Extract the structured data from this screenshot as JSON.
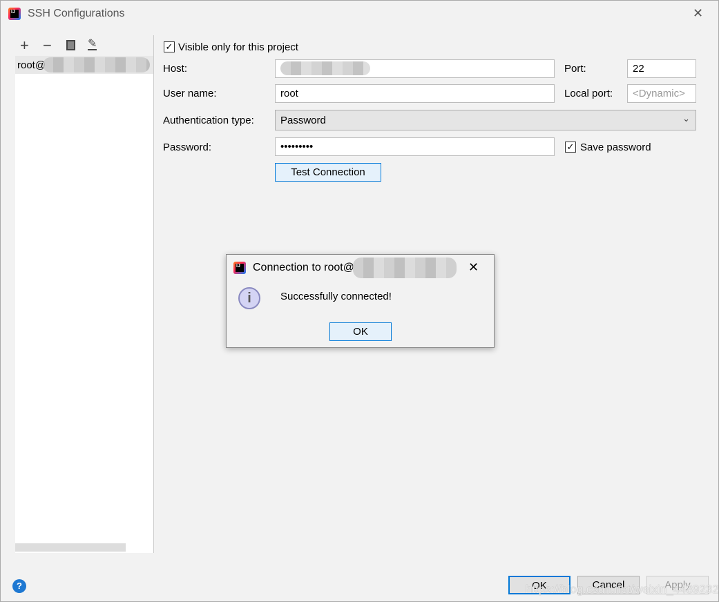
{
  "window": {
    "title": "SSH Configurations",
    "close": "✕"
  },
  "toolbar": {
    "add": "+",
    "remove": "−",
    "copy": "copy-icon",
    "edit": "edit-icon"
  },
  "list": {
    "items": [
      {
        "label": "root@"
      }
    ]
  },
  "form": {
    "visible_only": {
      "label": "Visible only for this project",
      "checked": true
    },
    "host_label": "Host:",
    "host_value": "",
    "port_label": "Port:",
    "port_value": "22",
    "user_label": "User name:",
    "user_value": "root",
    "local_port_label": "Local port:",
    "local_port_placeholder": "<Dynamic>",
    "auth_label": "Authentication type:",
    "auth_value": "Password",
    "password_label": "Password:",
    "password_value": "•••••••••",
    "save_password": {
      "label": "Save password",
      "checked": true
    },
    "test_connection": "Test Connection"
  },
  "dialog": {
    "title": "Connection to root@",
    "message": "Successfully connected!",
    "ok": "OK",
    "close": "✕"
  },
  "footer": {
    "help": "?",
    "ok": "OK",
    "cancel": "Cancel",
    "apply": "Apply",
    "watermark": "https://blog.csdn.net/weixin_44892327"
  }
}
